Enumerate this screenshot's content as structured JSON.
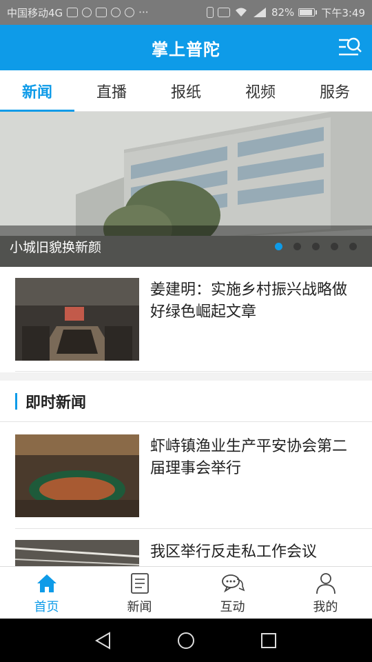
{
  "status_bar": {
    "carrier": "中国移动4G",
    "battery": "82%",
    "battery_level": 0.82,
    "time": "下午3:49",
    "signal": "46"
  },
  "header": {
    "title": "掌上普陀",
    "menu_icon": "menu-search-icon"
  },
  "tabs": [
    {
      "label": "新闻",
      "active": true
    },
    {
      "label": "直播",
      "active": false
    },
    {
      "label": "报纸",
      "active": false
    },
    {
      "label": "视频",
      "active": false
    },
    {
      "label": "服务",
      "active": false
    }
  ],
  "banner": {
    "caption": "小城旧貌换新颜",
    "dot_count": 5,
    "active_dot": 0
  },
  "news": [
    {
      "title": "姜建明：实施乡村振兴战略做好绿色崛起文章"
    }
  ],
  "section": {
    "title": "即时新闻"
  },
  "instant_news": [
    {
      "title": "虾峙镇渔业生产平安协会第二届理事会举行"
    },
    {
      "title": "我区举行反走私工作会议"
    }
  ],
  "bottom_nav": [
    {
      "label": "首页",
      "icon": "home-icon",
      "active": true
    },
    {
      "label": "新闻",
      "icon": "document-icon",
      "active": false
    },
    {
      "label": "互动",
      "icon": "chat-icon",
      "active": false
    },
    {
      "label": "我的",
      "icon": "user-icon",
      "active": false
    }
  ],
  "colors": {
    "accent": "#0e9be8",
    "status_bar": "#7a7a7a"
  }
}
